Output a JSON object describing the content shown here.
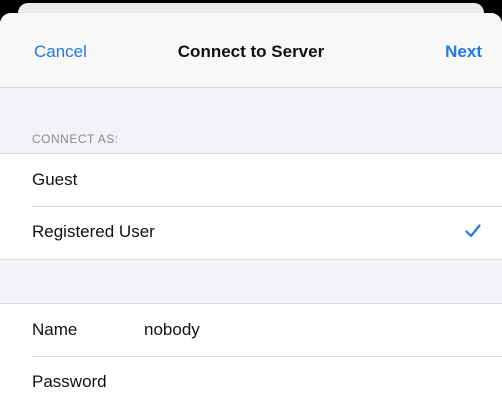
{
  "nav": {
    "cancel_label": "Cancel",
    "title": "Connect to Server",
    "next_label": "Next"
  },
  "connect_as": {
    "header": "CONNECT AS:",
    "options": [
      {
        "label": "Guest",
        "selected": false
      },
      {
        "label": "Registered User",
        "selected": true
      }
    ]
  },
  "credentials": {
    "name_label": "Name",
    "name_value": "nobody",
    "password_label": "Password",
    "password_value": ""
  },
  "colors": {
    "accent": "#1f7ae6",
    "background": "#f2f2f7",
    "text": "#111111",
    "secondary_text": "#8a8a8e"
  },
  "icons": {
    "selected_marker": "checkmark-icon"
  }
}
